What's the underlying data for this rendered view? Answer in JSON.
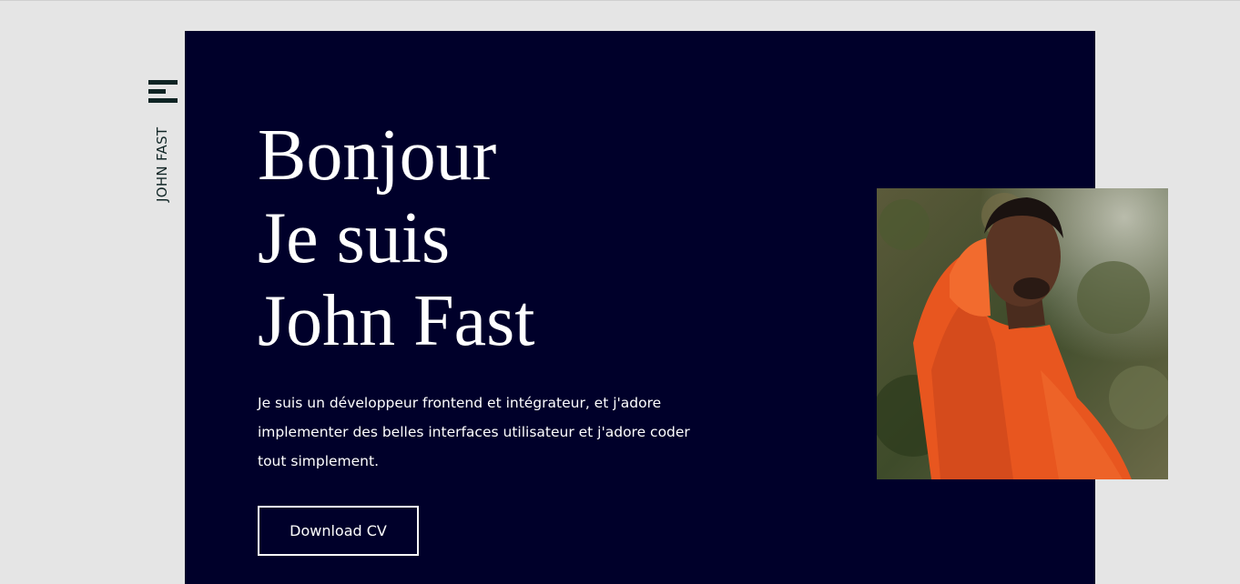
{
  "nav": {
    "brand": "JOHN FAST",
    "menu_icon": "menu-icon"
  },
  "hero": {
    "title_lines": [
      "Bonjour",
      "Je suis",
      "John Fast"
    ],
    "description": "Je suis un développeur frontend et intégrateur, et j'adore implementer des belles interfaces utilisateur et j'adore coder tout simplement.",
    "cta_label": "Download CV"
  },
  "colors": {
    "page_background": "#e5e5e5",
    "hero_background": "#00002a",
    "accent_dark": "#0f2424",
    "text_light": "#ffffff",
    "hoodie": "#e8561f"
  }
}
